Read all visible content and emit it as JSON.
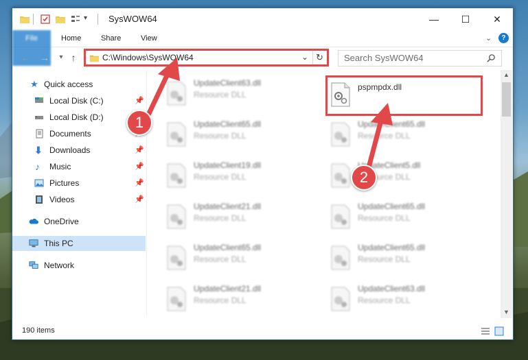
{
  "window": {
    "title": "SysWOW64",
    "controls": {
      "minimize": "—",
      "maximize": "☐",
      "close": "✕"
    }
  },
  "ribbon": {
    "tabs": [
      "File",
      "Home",
      "Share",
      "View"
    ],
    "expand_icon": "chevron-down-icon",
    "help_icon": "help-icon"
  },
  "address": {
    "path": "C:\\Windows\\SysWOW64",
    "search_placeholder": "Search SysWOW64"
  },
  "sidebar": {
    "items": [
      {
        "label": "Quick access",
        "icon": "star-icon",
        "pinned": false
      },
      {
        "label": "Local Disk (C:)",
        "icon": "drive-icon",
        "pinned": true
      },
      {
        "label": "Local Disk (D:)",
        "icon": "drive-icon",
        "pinned": false
      },
      {
        "label": "Documents",
        "icon": "documents-icon",
        "pinned": true
      },
      {
        "label": "Downloads",
        "icon": "download-icon",
        "pinned": true
      },
      {
        "label": "Music",
        "icon": "music-icon",
        "pinned": true
      },
      {
        "label": "Pictures",
        "icon": "pictures-icon",
        "pinned": true
      },
      {
        "label": "Videos",
        "icon": "video-icon",
        "pinned": true
      },
      {
        "label": "OneDrive",
        "icon": "cloud-icon",
        "pinned": false
      },
      {
        "label": "This PC",
        "icon": "computer-icon",
        "pinned": false,
        "selected": true
      },
      {
        "label": "Network",
        "icon": "network-icon",
        "pinned": false
      }
    ]
  },
  "files": [
    {
      "name": "UpdateClient63.dll",
      "type": "Resource DLL"
    },
    {
      "name": "pspmpdx.dll",
      "type": ""
    },
    {
      "name": "UpdateClient65.dll",
      "type": "Resource DLL"
    },
    {
      "name": "UpdateClient65.dll",
      "type": "Resource DLL"
    },
    {
      "name": "UpdateClient19.dll",
      "type": "Resource DLL"
    },
    {
      "name": "UpdateClient5.dll",
      "type": "Resource DLL"
    },
    {
      "name": "UpdateClient21.dll",
      "type": "Resource DLL"
    },
    {
      "name": "UpdateClient65.dll",
      "type": "Resource DLL"
    },
    {
      "name": "UpdateClient65.dll",
      "type": "Resource DLL"
    },
    {
      "name": "UpdateClient65.dll",
      "type": "Resource DLL"
    },
    {
      "name": "UpdateClient21.dll",
      "type": "Resource DLL"
    },
    {
      "name": "UpdateClient63.dll",
      "type": "Resource DLL"
    }
  ],
  "status": {
    "item_count": "190 items"
  },
  "annotations": {
    "step1": "1",
    "step2": "2",
    "color": "#e0484a"
  }
}
